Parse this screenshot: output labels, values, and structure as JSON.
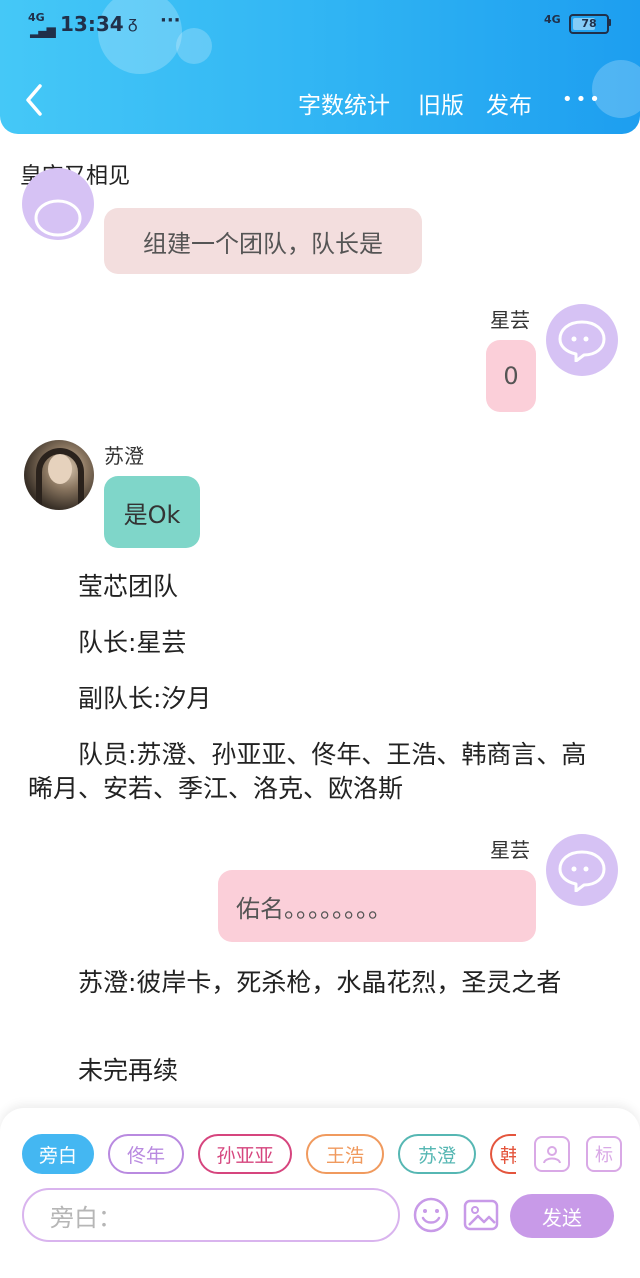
{
  "status_bar": {
    "network_left": "4G",
    "signal": "ıı",
    "time": "13:34",
    "notification_icon": "gallery-icon",
    "dots": "···",
    "network_right": "4G",
    "battery_level": 78,
    "battery_text": "78"
  },
  "header": {
    "back_icon": "chevron-left-icon",
    "actions": [
      "字数统计",
      "旧版",
      "发布"
    ],
    "more_icon": "more-horizontal-icon",
    "more_label": "•••"
  },
  "title": "皇宫又相见",
  "messages": [
    {
      "speaker": "",
      "side": "left",
      "text": "组建一个团队，队长是",
      "color": "#f3dede"
    },
    {
      "speaker": "星芸",
      "side": "right",
      "text": "0",
      "color": "#fbcfd9"
    },
    {
      "speaker": "苏澄",
      "side": "left",
      "text": "是Ok",
      "color": "#7fd6c9"
    },
    {
      "speaker": "星芸",
      "side": "right",
      "text": "佑名。。。。。。。。",
      "color": "#fbcfd9"
    }
  ],
  "narration": [
    "莹芯团队",
    "队长:星芸",
    "副队长:汐月",
    "队员:苏澄、孙亚亚、佟年、王浩、韩商言、高晞月、安若、季江、洛克、欧洛斯",
    "苏澄:彼岸卡，死杀枪，水晶花烈，圣灵之者",
    "未完再续"
  ],
  "toolbar": {
    "characters": [
      {
        "label": "旁白",
        "color": "#44b7f2",
        "active": true
      },
      {
        "label": "佟年",
        "color": "#b98ae0",
        "active": false
      },
      {
        "label": "孙亚亚",
        "color": "#d6457e",
        "active": false
      },
      {
        "label": "王浩",
        "color": "#f09a5e",
        "active": false
      },
      {
        "label": "苏澄",
        "color": "#56b7b3",
        "active": false
      },
      {
        "label": "韩",
        "color": "#e4553d",
        "active": false
      }
    ],
    "person_icon": "person-card-icon",
    "tag_label": "标",
    "input_placeholder": "旁白：",
    "emoji_icon": "smiley-icon",
    "image_icon": "image-icon",
    "send_label": "发送"
  },
  "colors": {
    "header_gradient_start": "#45c8f7",
    "header_gradient_end": "#1d9ef0",
    "avatar_bg": "#d6c2f4",
    "send_button": "#c89ae8"
  }
}
